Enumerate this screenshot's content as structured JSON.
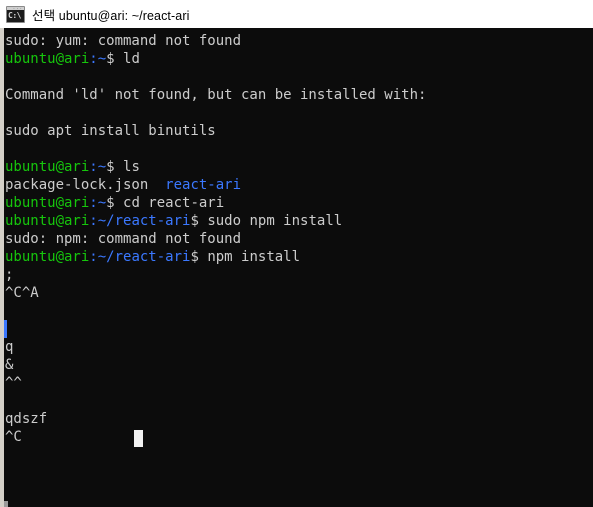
{
  "window": {
    "title_prefix": "선택",
    "title": "ubuntu@ari: ~/react-ari",
    "icon_name": "console-window-icon",
    "icon_glyph": "C:\\"
  },
  "theme": {
    "background": "#0c0c0c",
    "foreground": "#cccccc",
    "green": "#16c60c",
    "blue": "#3b78ff",
    "titlebar_bg": "#ffffff",
    "titlebar_fg": "#000000",
    "border": "#d4d0c8",
    "cursor": "#f2f2f2"
  },
  "terminal": {
    "user_host": "ubuntu@ari",
    "path_home": ":~",
    "path_project": ":~/react-ari",
    "sigil": "$",
    "lines": [
      {
        "type": "output",
        "text": "sudo: yum: command not found"
      },
      {
        "type": "prompt",
        "path": ":~",
        "command": " ld"
      },
      {
        "type": "blank",
        "text": ""
      },
      {
        "type": "output",
        "text": "Command 'ld' not found, but can be installed with:"
      },
      {
        "type": "blank",
        "text": ""
      },
      {
        "type": "output",
        "text": "sudo apt install binutils"
      },
      {
        "type": "blank",
        "text": ""
      },
      {
        "type": "prompt",
        "path": ":~",
        "command": " ls"
      },
      {
        "type": "ls",
        "plain": "package-lock.json",
        "gap": "  ",
        "dir": "react-ari"
      },
      {
        "type": "prompt",
        "path": ":~",
        "command": " cd react-ari"
      },
      {
        "type": "prompt",
        "path": ":~/react-ari",
        "command": " sudo npm install"
      },
      {
        "type": "output",
        "text": "sudo: npm: command not found"
      },
      {
        "type": "prompt",
        "path": ":~/react-ari",
        "command": " npm install"
      },
      {
        "type": "output",
        "text": ";"
      },
      {
        "type": "output",
        "text": "^C^A"
      },
      {
        "type": "blank",
        "text": ""
      },
      {
        "type": "blank",
        "text": ""
      },
      {
        "type": "output",
        "text": "q"
      },
      {
        "type": "output",
        "text": "&"
      },
      {
        "type": "output",
        "text": "^^"
      },
      {
        "type": "blank",
        "text": ""
      },
      {
        "type": "output",
        "text": "qdszf"
      },
      {
        "type": "output",
        "text": "^C"
      }
    ]
  }
}
